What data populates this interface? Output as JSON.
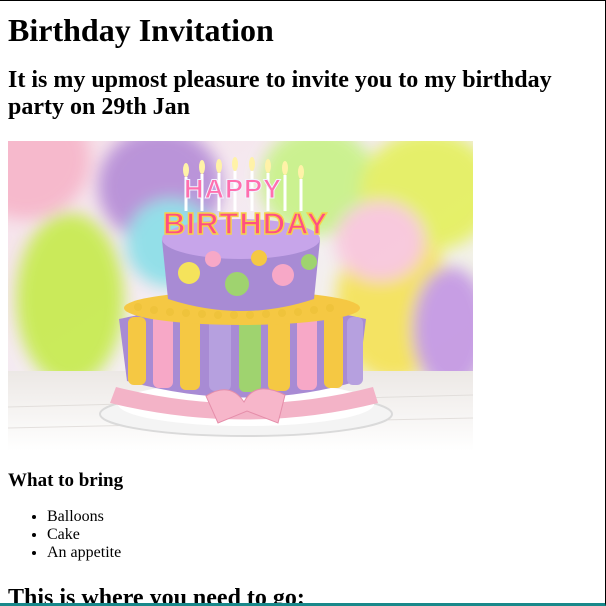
{
  "page": {
    "title": "Birthday Invitation",
    "invitation": "It is my upmost pleasure to invite you to my birthday party on 29th Jan"
  },
  "image": {
    "cake_topper_lines": [
      "HAPPY",
      "BIRTHDAY"
    ],
    "colors": {
      "background": "#f3e7ea",
      "balloon_purple": "#b790d8",
      "balloon_lime": "#c8eb52",
      "balloon_yellow": "#f5e35b",
      "cake_lilac": "#a88bd4",
      "cake_yellow": "#f5c843",
      "cake_pink": "#f7a8c7",
      "cake_green": "#9fd36f",
      "table": "#f1f0ee"
    }
  },
  "bring": {
    "heading": "What to bring",
    "items": [
      "Balloons",
      "Cake",
      "An appetite"
    ]
  },
  "location": {
    "heading": "This is where you need to go:"
  }
}
